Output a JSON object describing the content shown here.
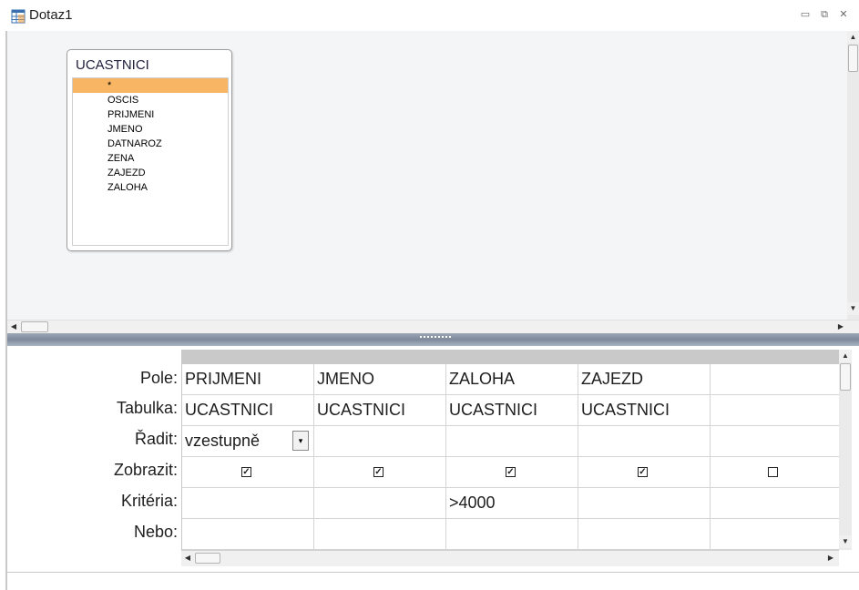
{
  "window": {
    "title": "Dotaz1",
    "minimize_glyph": "▭",
    "restore_glyph": "⧉",
    "close_glyph": "✕"
  },
  "table_box": {
    "title": "UCASTNICI",
    "fields": [
      "*",
      "OSCIS",
      "PRIJMENI",
      "JMENO",
      "DATNAROZ",
      "ZENA",
      "ZAJEZD",
      "ZALOHA"
    ],
    "selected_field": "*"
  },
  "grid": {
    "row_labels": [
      "Pole:",
      "Tabulka:",
      "Řadit:",
      "Zobrazit:",
      "Kritéria:",
      "Nebo:"
    ],
    "columns": [
      {
        "pole": "PRIJMENI",
        "tabulka": "UCASTNICI",
        "radit": "vzestupně",
        "zobrazit": true,
        "kriteria": "",
        "nebo": ""
      },
      {
        "pole": "JMENO",
        "tabulka": "UCASTNICI",
        "radit": "",
        "zobrazit": true,
        "kriteria": "",
        "nebo": ""
      },
      {
        "pole": "ZALOHA",
        "tabulka": "UCASTNICI",
        "radit": "",
        "zobrazit": true,
        "kriteria": ">4000",
        "nebo": ""
      },
      {
        "pole": "ZAJEZD",
        "tabulka": "UCASTNICI",
        "radit": "",
        "zobrazit": true,
        "kriteria": "",
        "nebo": ""
      },
      {
        "pole": "",
        "tabulka": "",
        "radit": "",
        "zobrazit": false,
        "kriteria": "",
        "nebo": ""
      }
    ],
    "check_glyph": "✓",
    "dropdown_glyph": "▾"
  },
  "colors": {
    "selected_field": "#f8b563",
    "upper_pane": "#f4f5f7",
    "column_header": "#c9c9c9"
  }
}
